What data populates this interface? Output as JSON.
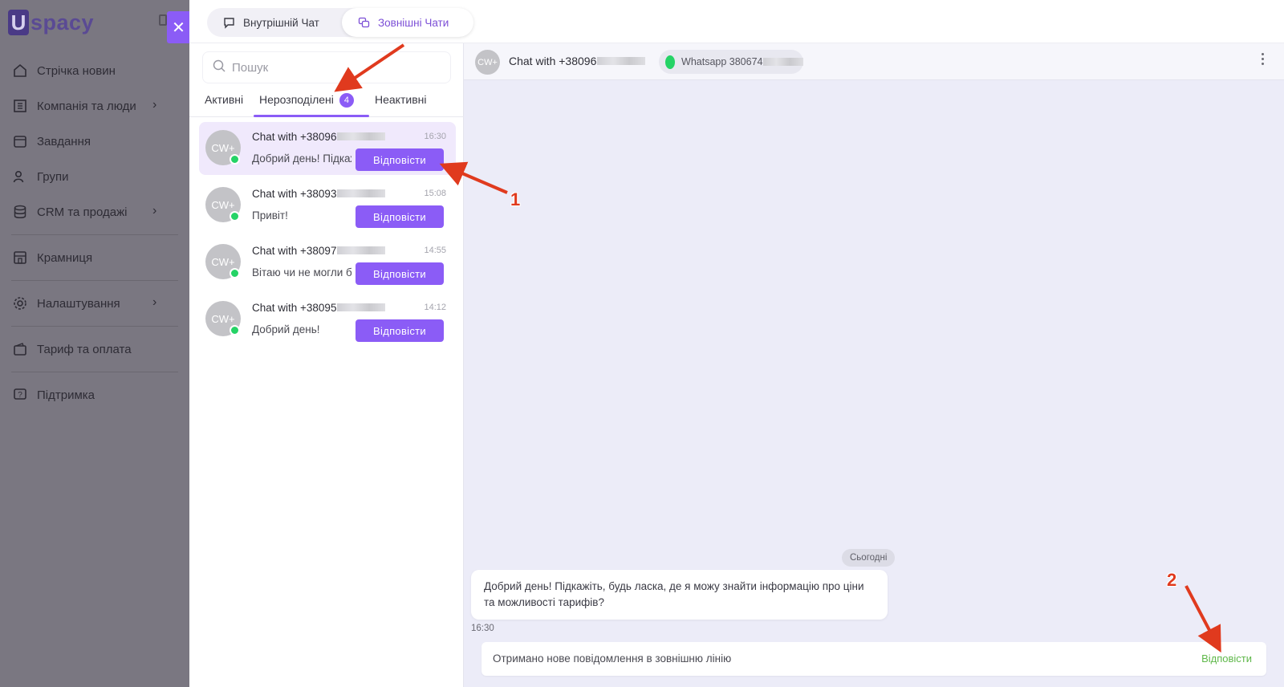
{
  "brand": {
    "logo_letter": "U",
    "logo_text": "spacy"
  },
  "sidebar": {
    "items": [
      {
        "label": "Стрічка новин",
        "icon": "home-icon",
        "has_chevron": false
      },
      {
        "label": "Компанія та люди",
        "icon": "building-icon",
        "has_chevron": true
      },
      {
        "label": "Завдання",
        "icon": "calendar-icon",
        "has_chevron": false
      },
      {
        "label": "Групи",
        "icon": "users-icon",
        "has_chevron": false
      },
      {
        "label": "CRM та продажі",
        "icon": "database-icon",
        "has_chevron": true
      },
      {
        "label": "Крамниця",
        "icon": "store-icon",
        "has_chevron": false
      },
      {
        "label": "Налаштування",
        "icon": "gear-icon",
        "has_chevron": true
      },
      {
        "label": "Тариф та оплата",
        "icon": "wallet-icon",
        "has_chevron": false
      },
      {
        "label": "Підтримка",
        "icon": "help-icon",
        "has_chevron": false
      }
    ],
    "close_label": "✕"
  },
  "chat_mode": {
    "internal_label": "Внутрішній Чат",
    "external_label": "Зовнішні Чати",
    "active": "external"
  },
  "search": {
    "placeholder": "Пошук"
  },
  "tabs": {
    "active": "Нерозподілені",
    "items": [
      {
        "label": "Активні"
      },
      {
        "label": "Нерозподілені",
        "badge": "4"
      },
      {
        "label": "Неактивні"
      }
    ]
  },
  "chats": [
    {
      "name": "Chat with +38096",
      "time": "16:30",
      "preview": "Добрий день! Підкажіть",
      "avatar": "CW+",
      "reply_label": "Відповісти",
      "selected": true
    },
    {
      "name": "Chat with +38093",
      "time": "15:08",
      "preview": "Привіт!",
      "avatar": "CW+",
      "reply_label": "Відповісти",
      "selected": false
    },
    {
      "name": "Chat with +38097",
      "time": "14:55",
      "preview": "Вітаю чи не могли б",
      "avatar": "CW+",
      "reply_label": "Відповісти",
      "selected": false
    },
    {
      "name": "Chat with +38095",
      "time": "14:12",
      "preview": "Добрий день!",
      "avatar": "CW+",
      "reply_label": "Відповісти",
      "selected": false
    }
  ],
  "conversation": {
    "avatar": "CW+",
    "title": "Chat with +38096",
    "channel_label": "Whatsapp 380674",
    "date_separator": "Сьогодні",
    "message_text": "Добрий день! Підкажіть, будь ласка, де я можу знайти інформацію про ціни та можливості тарифів?",
    "message_time": "16:30",
    "notice_text": "Отримано нове повідомлення в зовнішню лінію",
    "notice_action": "Відповісти"
  },
  "annotations": {
    "label_1": "1",
    "label_2": "2",
    "arrow_color": "#e03a1e"
  },
  "colors": {
    "accent": "#8b5cf6",
    "whatsapp": "#25d366",
    "notice_link": "#5fb84a"
  }
}
